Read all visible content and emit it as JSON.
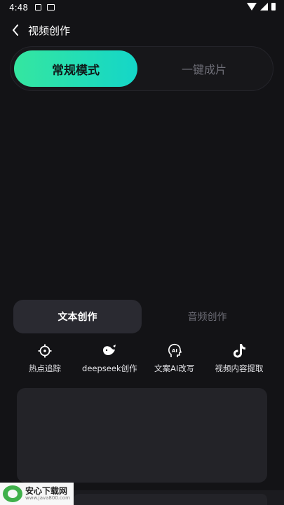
{
  "status": {
    "time": "4:48"
  },
  "header": {
    "title": "视频创作"
  },
  "mode": {
    "active": "常规模式",
    "inactive": "一键成片"
  },
  "sub_tabs": {
    "active": "文本创作",
    "inactive": "音频创作"
  },
  "tools": [
    {
      "label": "热点追踪",
      "icon": "crosshair-icon"
    },
    {
      "label": "deepseek创作",
      "icon": "whale-icon"
    },
    {
      "label": "文案AI改写",
      "icon": "ai-head-icon"
    },
    {
      "label": "视频内容提取",
      "icon": "tiktok-icon"
    }
  ],
  "watermark": {
    "title": "安心下载网",
    "url": "www.java800.com"
  }
}
